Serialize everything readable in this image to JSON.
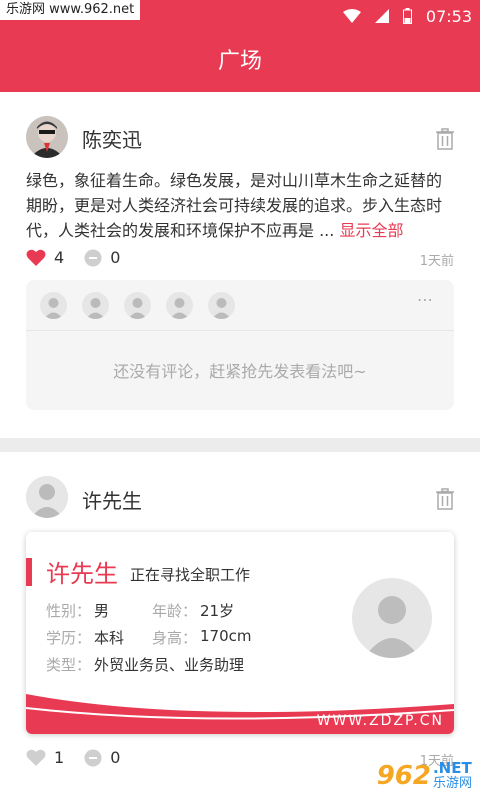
{
  "status_bar": {
    "watermark": "乐游网 www.962.net",
    "time": "07:53"
  },
  "app_bar": {
    "title": "广场"
  },
  "post1": {
    "author": "陈奕迅",
    "text": "绿色，象征着生命。绿色发展，是对山川草木生命之延替的期盼，更是对人类经济社会可持续发展的追求。步入生态时代，人类社会的发展和环境保护不应再是 ... ",
    "show_all": "显示全部",
    "likes": "4",
    "comments": "0",
    "time": "1天前",
    "more_icon": "⋯",
    "empty_comment": "还没有评论，赶紧抢先发表看法吧~"
  },
  "post2": {
    "author": "许先生",
    "likes": "1",
    "comments": "0",
    "time": "1天前",
    "resume": {
      "name": "许先生",
      "status": "正在寻找全职工作",
      "gender_label": "性别：",
      "gender": "男",
      "age_label": "年龄：",
      "age": "21岁",
      "education_label": "学历：",
      "education": "本科",
      "height_label": "身高：",
      "height": "170cm",
      "type_label": "类型：",
      "type": "外贸业务员、业务助理",
      "site": "WWW.ZDZP.CN"
    }
  },
  "watermark_bottom": {
    "num": "962",
    "net": ".NET",
    "cn": "乐游网"
  },
  "colors": {
    "accent": "#e83a52",
    "background": "#ececec"
  }
}
